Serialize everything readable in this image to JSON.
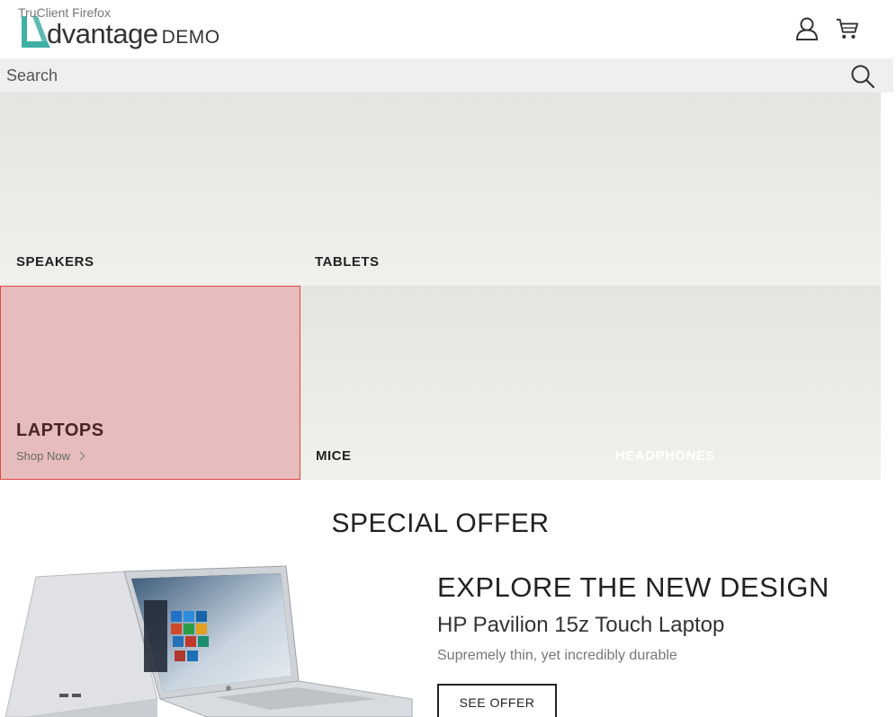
{
  "window": {
    "title": "TruClient Firefox"
  },
  "header": {
    "logo_text": "dvantage",
    "logo_suffix": "DEMO",
    "user_icon": "user-icon",
    "cart_icon": "cart-icon"
  },
  "search": {
    "placeholder": "Search",
    "icon": "search-icon"
  },
  "categories": [
    {
      "label": "SPEAKERS"
    },
    {
      "label": "TABLETS"
    },
    {
      "label": "LAPTOPS",
      "action": "Shop Now"
    },
    {
      "label": "MICE"
    },
    {
      "label": "HEADPHONES"
    }
  ],
  "special_offer": {
    "title": "SPECIAL OFFER",
    "heading": "EXPLORE THE NEW DESIGN",
    "product": "HP Pavilion 15z Touch Laptop",
    "description": "Supremely thin, yet incredibly durable",
    "button_label": "SEE OFFER"
  },
  "colors": {
    "brand_teal": "#3fb0a6",
    "laptops_highlight": "#e7bcbc",
    "highlight_border": "#e04848",
    "search_bg": "#efefef"
  }
}
